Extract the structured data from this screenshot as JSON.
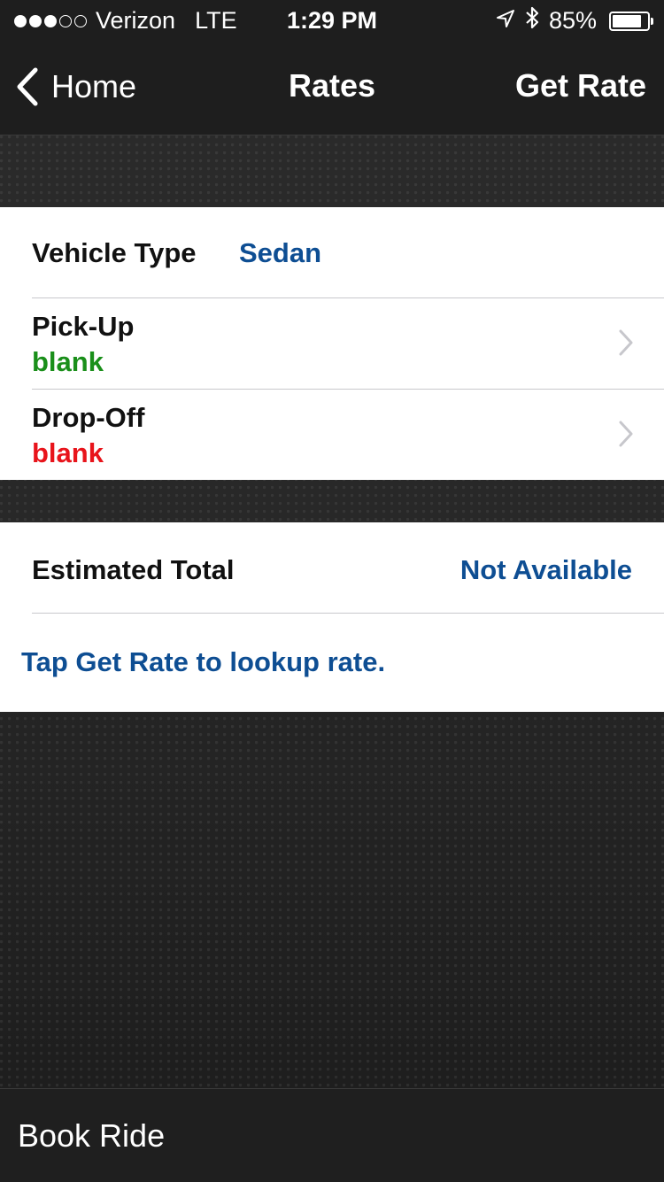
{
  "status_bar": {
    "carrier": "Verizon",
    "network": "LTE",
    "time": "1:29 PM",
    "battery_percent": "85%",
    "battery_level": 0.85,
    "signal_bars_filled": 3,
    "signal_bars_total": 5
  },
  "nav": {
    "back_label": "Home",
    "title": "Rates",
    "action_label": "Get Rate"
  },
  "vehicle": {
    "label": "Vehicle Type",
    "value": "Sedan"
  },
  "pickup": {
    "label": "Pick-Up",
    "value": "blank"
  },
  "dropoff": {
    "label": "Drop-Off",
    "value": "blank"
  },
  "estimate": {
    "label": "Estimated Total",
    "value": "Not Available",
    "hint": "Tap Get Rate to lookup rate."
  },
  "bottom": {
    "book_label": "Book Ride"
  },
  "colors": {
    "link_blue": "#0e4e93",
    "pickup_green": "#1a8f1a",
    "dropoff_red": "#e8141b"
  }
}
